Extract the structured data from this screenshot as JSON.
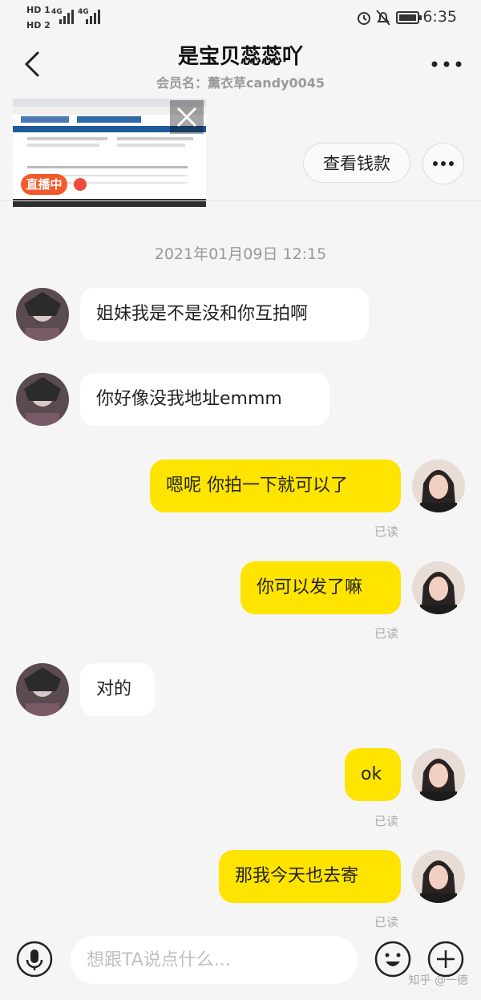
{
  "status_bar": {
    "sig1": "HD 1",
    "sig2": "HD 2",
    "net1": "4G",
    "net2": "4G",
    "time": "6:35"
  },
  "header": {
    "title": "是宝贝蕊蕊吖",
    "member_line": "会员名：薰衣草candy0045"
  },
  "live": {
    "badge": "直播中"
  },
  "actions": {
    "view_money": "查看钱款"
  },
  "timestamp": "2021年01月09日 12:15",
  "messages": [
    {
      "text": "姐妹我是不是没和你互拍啊"
    },
    {
      "text": "你好像没我地址emmm"
    },
    {
      "text": "嗯呢 你拍一下就可以了",
      "status": "已读"
    },
    {
      "text": "你可以发了嘛",
      "status": "已读"
    },
    {
      "text": "对的"
    },
    {
      "text": "ok",
      "status": "已读"
    },
    {
      "text": "那我今天也去寄",
      "status": "已读"
    }
  ],
  "input": {
    "placeholder": "想跟TA说点什么..."
  },
  "watermark": "知乎 @一德",
  "colors": {
    "outgoing_bubble": "#ffe400",
    "incoming_bubble": "#ffffff",
    "live_badge": "#f25a2c",
    "background": "#f5f5f5"
  }
}
